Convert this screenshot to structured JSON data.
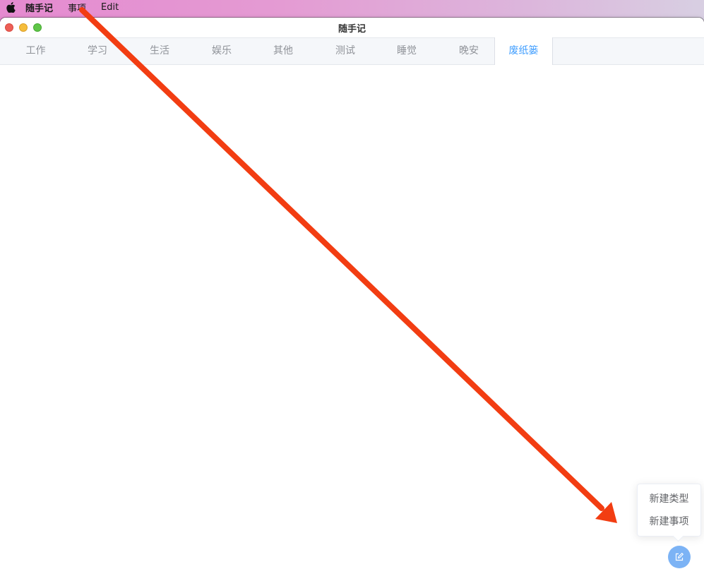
{
  "menubar": {
    "app_name": "随手记",
    "items": [
      "事项",
      "Edit"
    ]
  },
  "window": {
    "title": "随手记"
  },
  "tabs": [
    {
      "label": "工作",
      "active": false
    },
    {
      "label": "学习",
      "active": false
    },
    {
      "label": "生活",
      "active": false
    },
    {
      "label": "娱乐",
      "active": false
    },
    {
      "label": "其他",
      "active": false
    },
    {
      "label": "测试",
      "active": false
    },
    {
      "label": "睡觉",
      "active": false
    },
    {
      "label": "晚安",
      "active": false
    },
    {
      "label": "废纸篓",
      "active": true
    }
  ],
  "popover": {
    "items": [
      "新建类型",
      "新建事项"
    ]
  },
  "fab": {
    "icon": "edit-icon"
  },
  "colors": {
    "accent": "#409eff",
    "fab": "#7cb3f5",
    "annotation_arrow": "#f23d12"
  }
}
